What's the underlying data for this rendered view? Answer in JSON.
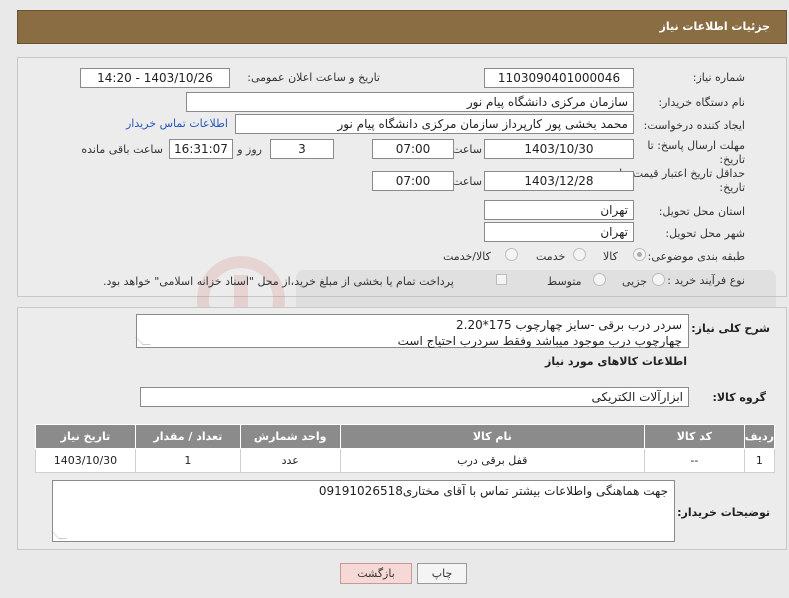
{
  "header": {
    "title": "جزئیات اطلاعات نیاز"
  },
  "fields": {
    "need_number_label": "شماره نیاز:",
    "need_number": "1103090401000046",
    "announce_label": "تاریخ و ساعت اعلان عمومی:",
    "announce_value": "1403/10/26 - 14:20",
    "buyer_org_label": "نام دستگاه خریدار:",
    "buyer_org": "سازمان مرکزی دانشگاه پیام نور",
    "creator_label": "ایجاد کننده درخواست:",
    "creator": "محمد بخشی پور کارپرداز سازمان مرکزی دانشگاه پیام نور",
    "contact_link": "اطلاعات تماس خریدار",
    "deadline_label_1": "مهلت ارسال پاسخ: تا",
    "deadline_label_2": "تاریخ:",
    "deadline_date": "1403/10/30",
    "time_label": "ساعت",
    "deadline_time": "07:00",
    "days_count": "3",
    "days_label": "روز و",
    "remaining_time": "16:31:07",
    "remaining_label": "ساعت باقی مانده",
    "price_label_1": "حداقل تاریخ اعتبار قیمت: تا",
    "price_label_2": "تاریخ:",
    "price_date": "1403/12/28",
    "price_time_label": "ساعت",
    "price_time": "07:00",
    "province_label": "استان محل تحویل:",
    "province": "تهران",
    "city_label": "شهر محل تحویل:",
    "city": "تهران",
    "category_label": "طبقه بندی موضوعی:",
    "category_options": [
      "کالا",
      "خدمت",
      "کالا/خدمت"
    ],
    "process_label": "نوع فرآیند خرید :",
    "process_options": [
      "جزیی",
      "متوسط"
    ],
    "process_note": "پرداخت تمام یا بخشی از مبلغ خرید،از محل \"اسناد خزانه اسلامی\" خواهد بود."
  },
  "description": {
    "label": "شرح کلی نیاز:",
    "line1": "سردر درب برقی -سایز چهارچوب 175*2.20",
    "line2": "چهارچوب درب موجود میباشد وفقط سردرب احتیاج است"
  },
  "goods": {
    "section_title": "اطلاعات کالاهای مورد نیاز",
    "group_label": "گروه کالا:",
    "group_value": "ابزارآلات الکتریکی",
    "columns": [
      "ردیف",
      "کد کالا",
      "نام کالا",
      "واحد شمارش",
      "تعداد / مقدار",
      "تاریخ نیاز"
    ],
    "rows": [
      [
        "1",
        "--",
        "قفل برقی درب",
        "عدد",
        "1",
        "1403/10/30"
      ]
    ]
  },
  "buyer_notes": {
    "label": "توضیحات خریدار:",
    "text": "جهت هماهنگی واطلاعات بیشتر تماس با آقای مختاری09191026518"
  },
  "buttons": {
    "print": "چاپ",
    "back": "بازگشت"
  },
  "colors": {
    "header_bg": "#8b6d43",
    "table_header_bg": "#8b8b8b",
    "link": "#2a57b8",
    "back_button_bg": "#f6d9d6"
  }
}
